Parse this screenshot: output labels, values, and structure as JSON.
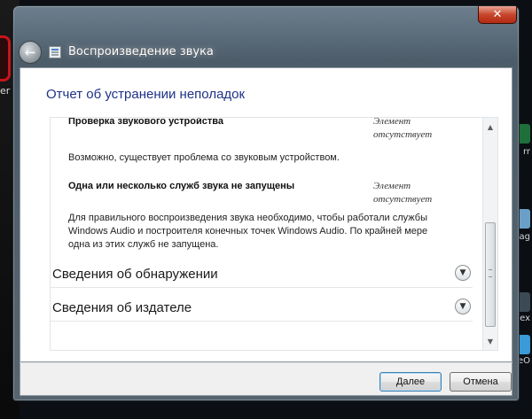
{
  "desktop": {
    "left_text": "er",
    "right_texts": [
      "rr",
      "ag",
      "ex",
      "eO"
    ]
  },
  "window": {
    "title": "Воспроизведение звука",
    "close_glyph": "✕",
    "back_glyph": "←"
  },
  "report": {
    "heading": "Отчет об устранении неполадок",
    "issues": [
      {
        "title": "Проверка звукового устройства",
        "status": "Элемент отсутствует",
        "description": "Возможно, существует проблема со звуковым устройством."
      },
      {
        "title": "Одна или несколько служб звука не запущены",
        "status": "Элемент отсутствует",
        "description": "Для правильного воспроизведения звука необходимо, чтобы работали службы Windows Audio и построителя конечных точек Windows Audio. По крайней мере одна из этих служб не запущена."
      }
    ],
    "sections": [
      {
        "label": "Сведения об обнаружении"
      },
      {
        "label": "Сведения об издателе"
      }
    ]
  },
  "footer": {
    "next_label": "Далее",
    "cancel_label": "Отмена"
  },
  "colors": {
    "heading": "#1e3287",
    "close_button": "#c7462c"
  }
}
